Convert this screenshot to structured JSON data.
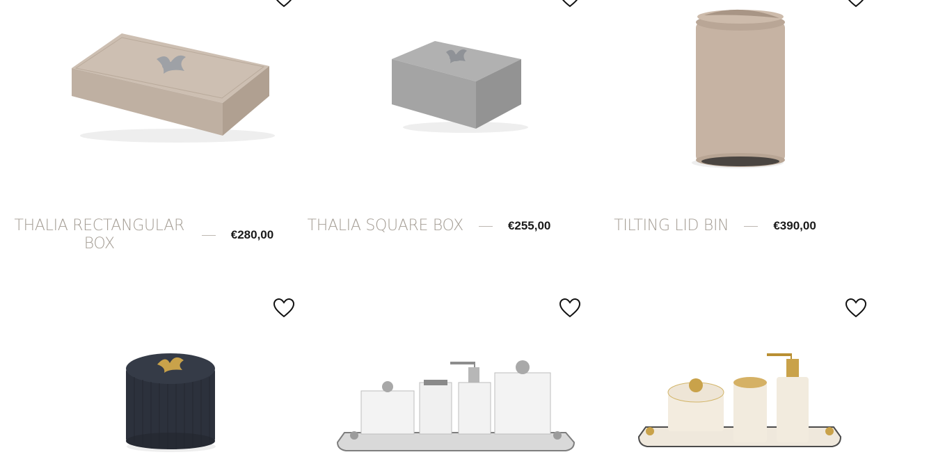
{
  "products": [
    {
      "name": "THALIA RECTANGULAR BOX",
      "price": "€280,00",
      "image": "thalia-rectangular-box",
      "color": "#c9b8a8"
    },
    {
      "name": "THALIA SQUARE BOX",
      "price": "€255,00",
      "image": "thalia-square-box",
      "color": "#a9a9a9"
    },
    {
      "name": "TILTING LID BIN",
      "price": "€390,00",
      "image": "tilting-lid-bin",
      "color": "#c4b09f"
    },
    {
      "name": "",
      "price": "",
      "image": "round-box-black",
      "color": "#2a2f3a"
    },
    {
      "name": "",
      "price": "",
      "image": "silver-bathroom-set",
      "color": "#e6e6e6"
    },
    {
      "name": "",
      "price": "",
      "image": "gold-ivory-bathroom-set",
      "color": "#efe8dc"
    }
  ],
  "icons": {
    "wishlist": "heart-outline-icon"
  }
}
